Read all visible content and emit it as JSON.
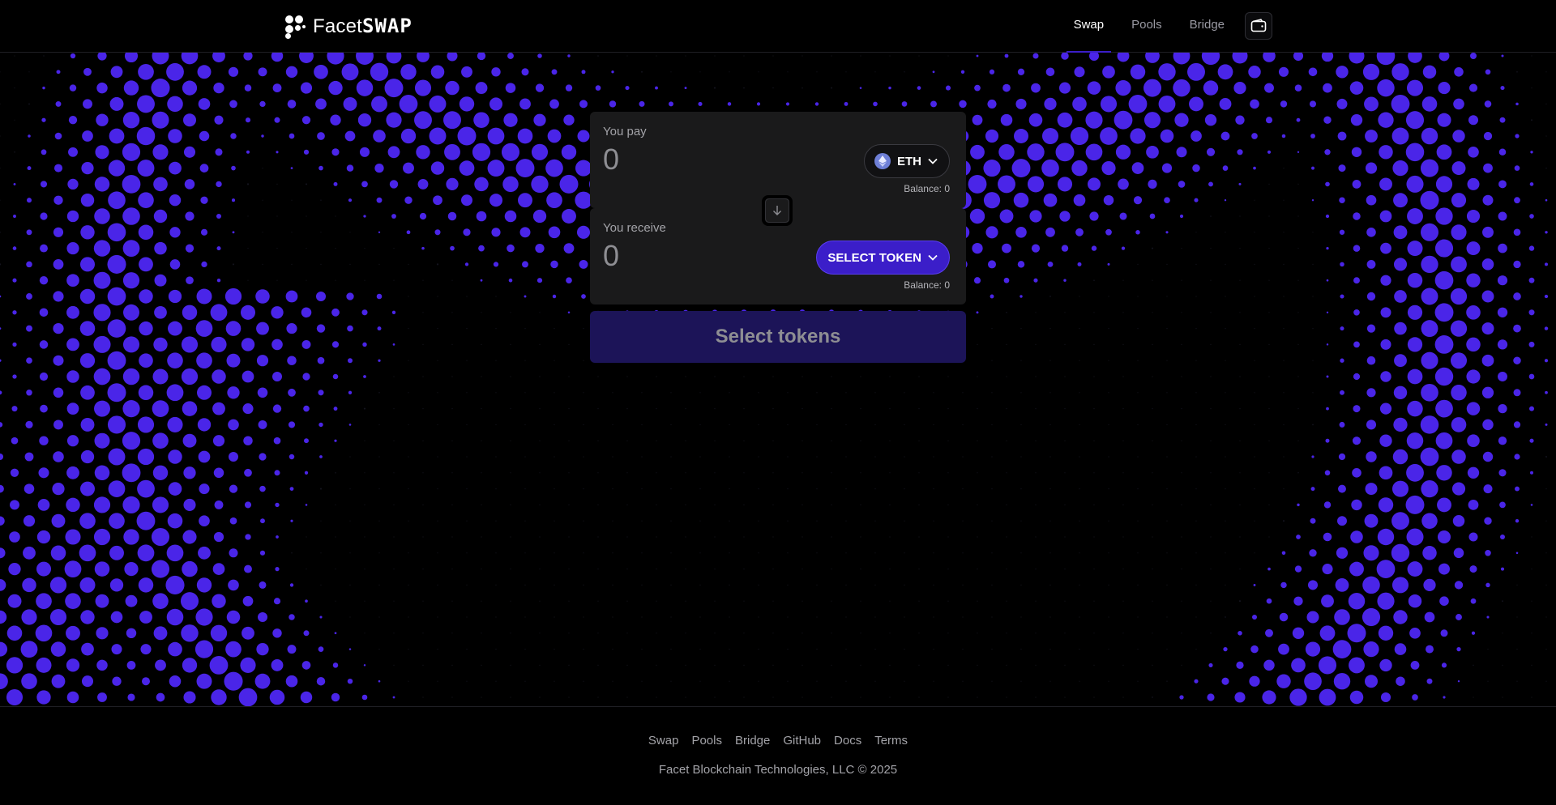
{
  "brand": {
    "name_prefix": "Facet",
    "name_suffix": "SWAP"
  },
  "nav": {
    "items": [
      {
        "label": "Swap",
        "active": true
      },
      {
        "label": "Pools",
        "active": false
      },
      {
        "label": "Bridge",
        "active": false
      }
    ],
    "wallet_icon": "wallet-icon"
  },
  "swap": {
    "pay": {
      "label": "You pay",
      "amount": "0",
      "token": "ETH",
      "balance": "Balance: 0"
    },
    "receive": {
      "label": "You receive",
      "amount": "0",
      "token": "SELECT TOKEN",
      "balance": "Balance: 0"
    },
    "flip_icon": "arrow-down-icon",
    "submit_label": "Select tokens"
  },
  "footer": {
    "links": [
      "Swap",
      "Pools",
      "Bridge",
      "GitHub",
      "Docs",
      "Terms"
    ],
    "copyright": "Facet Blockchain Technologies, LLC © 2025"
  },
  "colors": {
    "background": "#000000",
    "accent": "#3b1ec9",
    "dot": "#4a25e8",
    "panel": "#1a1a1b",
    "submit_disabled": "#1c1458"
  }
}
